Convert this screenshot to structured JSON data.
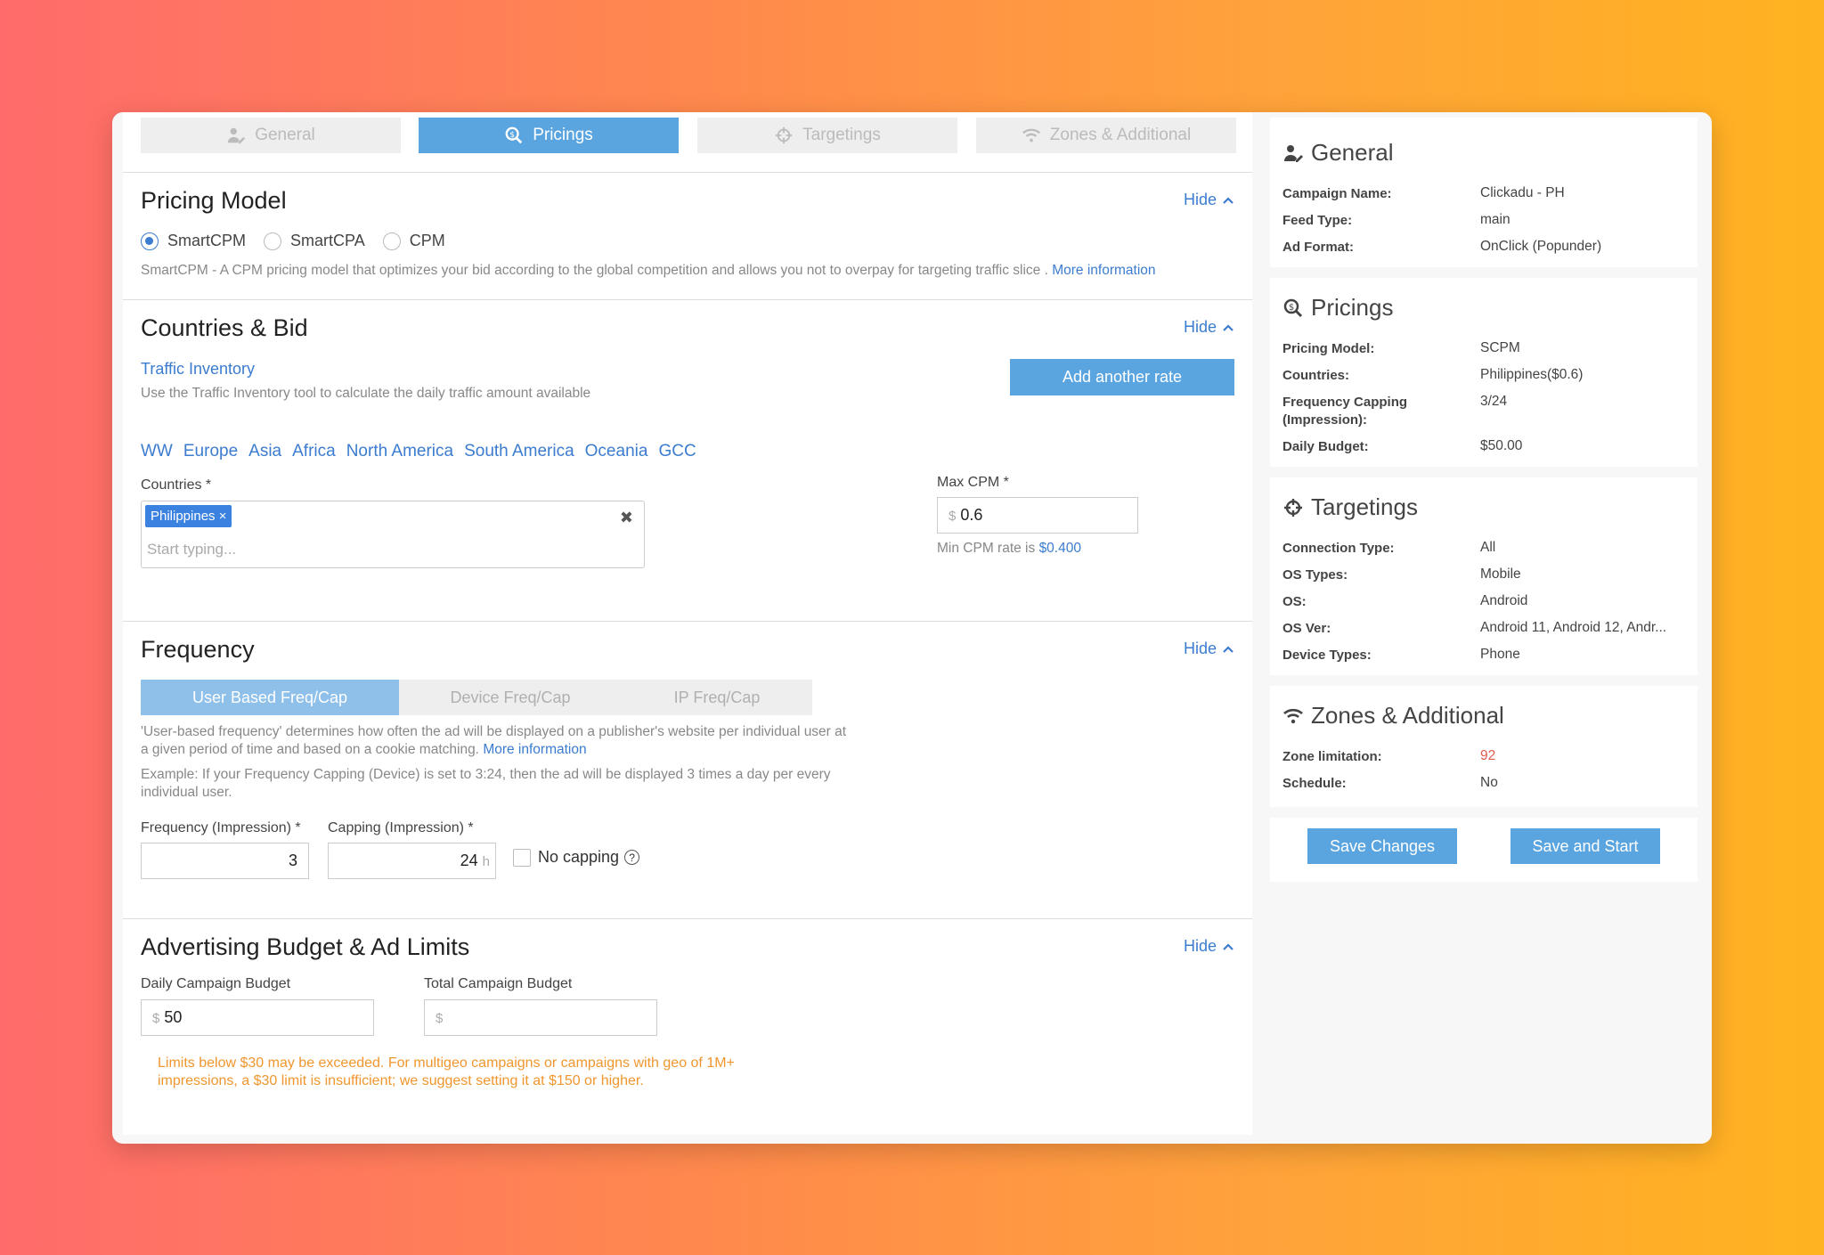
{
  "tabs": [
    {
      "label": "General",
      "icon": "user-edit-icon"
    },
    {
      "label": "Pricings",
      "icon": "search-dollar-icon"
    },
    {
      "label": "Targetings",
      "icon": "crosshair-icon"
    },
    {
      "label": "Zones & Additional",
      "icon": "wifi-icon"
    }
  ],
  "hide_label": "Hide",
  "pricing_model": {
    "title": "Pricing Model",
    "options": [
      "SmartCPM",
      "SmartCPA",
      "CPM"
    ],
    "selected": "SmartCPM",
    "description": "SmartCPM - A CPM pricing model that optimizes your bid according to the global competition and allows you not to overpay for targeting traffic slice .",
    "more_info": "More information"
  },
  "countries_bid": {
    "title": "Countries & Bid",
    "traffic_inventory": "Traffic Inventory",
    "traffic_desc": "Use the Traffic Inventory tool to calculate the daily traffic amount available",
    "add_rate": "Add another rate",
    "regions": [
      "WW",
      "Europe",
      "Asia",
      "Africa",
      "North America",
      "South America",
      "Oceania",
      "GCC"
    ],
    "countries_label": "Countries  *",
    "country_tag": "Philippines ×",
    "clear_icon": "✖",
    "countries_placeholder": "Start typing...",
    "max_cpm_label": "Max CPM  *",
    "currency": "$",
    "max_cpm_value": "0.6",
    "min_cpm_text": "Min CPM rate is",
    "min_cpm_value": "$0.400"
  },
  "frequency": {
    "title": "Frequency",
    "tabs": [
      "User Based Freq/Cap",
      "Device Freq/Cap",
      "IP Freq/Cap"
    ],
    "desc1a": "'User-based frequency' determines how often the ad will be displayed on a publisher's website per individual user at",
    "desc1b": "a given period of time and based on a cookie matching.",
    "more_info": "More information",
    "desc2a": "Example: If your Frequency Capping (Device) is set to 3:24, then the ad will be displayed 3 times a day per every",
    "desc2b": "individual user.",
    "freq_label": "Frequency (Impression) *",
    "freq_value": "3",
    "cap_label": "Capping (Impression) *",
    "cap_value": "24",
    "cap_unit": "h",
    "no_capping": "No capping",
    "help_icon": "?"
  },
  "budget": {
    "title": "Advertising Budget & Ad Limits",
    "daily_label": "Daily Campaign Budget",
    "daily_value": "50",
    "total_label": "Total Campaign Budget",
    "currency": "$",
    "warn1": "Limits below $30 may be exceeded. For multigeo campaigns or campaigns with geo of 1M+",
    "warn2": "impressions, a $30 limit is insufficient; we suggest setting it at $150 or higher."
  },
  "summary": {
    "general": {
      "title": "General",
      "rows": [
        {
          "k": "Campaign Name:",
          "v": "Clickadu - PH"
        },
        {
          "k": "Feed Type:",
          "v": "main"
        },
        {
          "k": "Ad Format:",
          "v": "OnClick (Popunder)"
        }
      ]
    },
    "pricings": {
      "title": "Pricings",
      "rows": [
        {
          "k": "Pricing Model:",
          "v": "SCPM"
        },
        {
          "k": "Countries:",
          "v": "Philippines($0.6)"
        },
        {
          "k": "Frequency Capping (Impression):",
          "v": "3/24"
        },
        {
          "k": "Daily Budget:",
          "v": "$50.00"
        }
      ]
    },
    "targetings": {
      "title": "Targetings",
      "rows": [
        {
          "k": "Connection Type:",
          "v": "All"
        },
        {
          "k": "OS Types:",
          "v": "Mobile"
        },
        {
          "k": "OS:",
          "v": "Android"
        },
        {
          "k": "OS Ver:",
          "v": "Android 11, Android 12, Andr..."
        },
        {
          "k": "Device Types:",
          "v": "Phone"
        }
      ]
    },
    "zones": {
      "title": "Zones & Additional",
      "rows": [
        {
          "k": "Zone limitation:",
          "v": "92"
        },
        {
          "k": "Schedule:",
          "v": "No"
        }
      ]
    },
    "save_changes": "Save Changes",
    "save_start": "Save and Start"
  },
  "colors": {
    "accent": "#5aa5e0",
    "link": "#3b7ccf",
    "warning": "#f0962e",
    "zone_value": "#e05a4a"
  }
}
